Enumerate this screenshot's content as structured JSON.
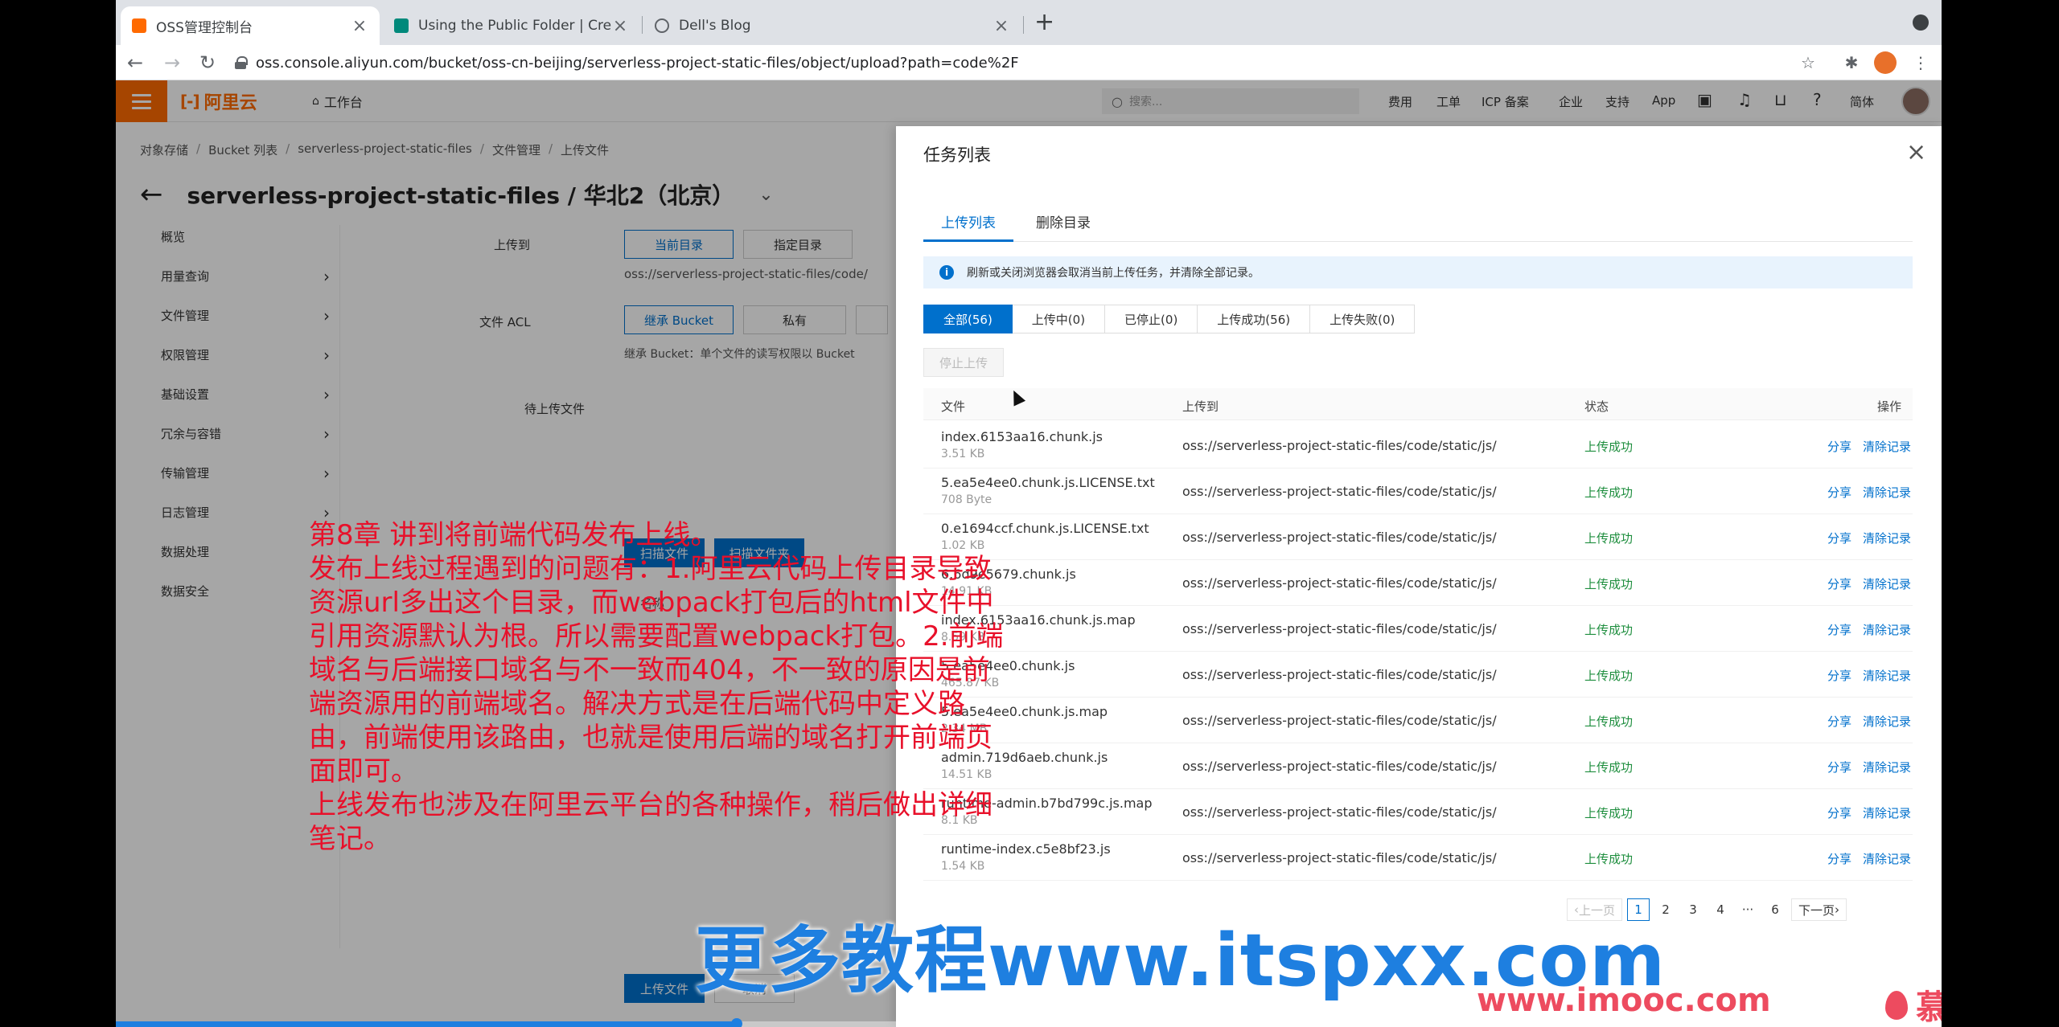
{
  "browser": {
    "tabs": [
      {
        "title": "OSS管理控制台",
        "color": "#ff6a00",
        "active": true
      },
      {
        "title": "Using the Public Folder | Creat",
        "color": "#00897b",
        "active": false
      },
      {
        "title": "Dell's Blog",
        "color": "#5f6368",
        "active": false
      }
    ],
    "new_tab": "+",
    "close": "×",
    "url": "oss.console.aliyun.com/bucket/oss-cn-beijing/serverless-project-static-files/object/upload?path=code%2F"
  },
  "console": {
    "brand": "阿里云",
    "brand_mark": "[-]",
    "workbench": "工作台",
    "search_placeholder": "搜索...",
    "top_links": [
      "费用",
      "工单",
      "ICP 备案",
      "企业",
      "支持",
      "App",
      "简体"
    ],
    "breadcrumb": [
      "对象存储",
      "Bucket 列表",
      "serverless-project-static-files",
      "文件管理",
      "上传文件"
    ],
    "bucket_title": "serverless-project-static-files / 华北2（北京）",
    "left_nav": [
      "概览",
      "用量查询",
      "文件管理",
      "权限管理",
      "基础设置",
      "冗余与容错",
      "传输管理",
      "日志管理",
      "数据处理",
      "数据安全"
    ],
    "form": {
      "upload_to_label": "上传到",
      "current_dir": "当前目录",
      "specify_dir": "指定目录",
      "path_preview": "oss://serverless-project-static-files/code/",
      "acl_label": "文件 ACL",
      "inherit_bucket": "继承 Bucket",
      "private": "私有",
      "acl_hint": "继承 Bucket：单个文件的读写权限以 Bucket",
      "pending_label": "待上传文件",
      "scan_file": "扫描文件",
      "scan_folder": "扫描文件夹",
      "name_col": "名称",
      "upload_btn": "上传文件",
      "cancel_btn": "取消"
    }
  },
  "panel": {
    "title": "任务列表",
    "tabs": [
      "上传列表",
      "删除目录"
    ],
    "notice": "刷新或关闭浏览器会取消当前上传任务，并清除全部记录。",
    "filters": [
      "全部(56)",
      "上传中(0)",
      "已停止(0)",
      "上传成功(56)",
      "上传失败(0)"
    ],
    "stop_btn": "停止上传",
    "columns": {
      "file": "文件",
      "dest": "上传到",
      "status": "状态",
      "ops": "操作"
    },
    "rows": [
      {
        "name": "index.6153aa16.chunk.js",
        "size": "3.51 KB",
        "dest": "oss://serverless-project-static-files/code/static/js/",
        "status": "上传成功",
        "share": "分享",
        "clear": "清除记录"
      },
      {
        "name": "5.ea5e4ee0.chunk.js.LICENSE.txt",
        "size": "708 Byte",
        "dest": "oss://serverless-project-static-files/code/static/js/",
        "status": "上传成功",
        "share": "分享",
        "clear": "清除记录"
      },
      {
        "name": "0.e1694ccf.chunk.js.LICENSE.txt",
        "size": "1.02 KB",
        "dest": "oss://serverless-project-static-files/code/static/js/",
        "status": "上传成功",
        "share": "分享",
        "clear": "清除记录"
      },
      {
        "name": "6.6d9e5679.chunk.js",
        "size": "14.91 KB",
        "dest": "oss://serverless-project-static-files/code/static/js/",
        "status": "上传成功",
        "share": "分享",
        "clear": "清除记录"
      },
      {
        "name": "index.6153aa16.chunk.js.map",
        "size": "8.59 KB",
        "dest": "oss://serverless-project-static-files/code/static/js/",
        "status": "上传成功",
        "share": "分享",
        "clear": "清除记录"
      },
      {
        "name": "5.ea5e4ee0.chunk.js",
        "size": "465.87 KB",
        "dest": "oss://serverless-project-static-files/code/static/js/",
        "status": "上传成功",
        "share": "分享",
        "clear": "清除记录"
      },
      {
        "name": "5.ea5e4ee0.chunk.js.map",
        "size": "2.34 MB",
        "dest": "oss://serverless-project-static-files/code/static/js/",
        "status": "上传成功",
        "share": "分享",
        "clear": "清除记录"
      },
      {
        "name": "admin.719d6aeb.chunk.js",
        "size": "14.51 KB",
        "dest": "oss://serverless-project-static-files/code/static/js/",
        "status": "上传成功",
        "share": "分享",
        "clear": "清除记录"
      },
      {
        "name": "runtime-admin.b7bd799c.js.map",
        "size": "8.1 KB",
        "dest": "oss://serverless-project-static-files/code/static/js/",
        "status": "上传成功",
        "share": "分享",
        "clear": "清除记录"
      },
      {
        "name": "runtime-index.c5e8bf23.js",
        "size": "1.54 KB",
        "dest": "oss://serverless-project-static-files/code/static/js/",
        "status": "上传成功",
        "share": "分享",
        "clear": "清除记录"
      }
    ],
    "pager": {
      "prev": "上一页",
      "pages": [
        "1",
        "2",
        "3",
        "4"
      ],
      "ellipsis": "···",
      "last": "6",
      "next": "下一页",
      "current": "1"
    }
  },
  "overlay": {
    "note_lines": [
      "第8章 讲到将前端代码发布上线。",
      "发布上线过程遇到的问题有：1.阿里云代码上传目录导致资源url多出这个目录，而webpack打包后的html文件中引用资源默认为根。所以需要配置webpack打包。2.前端域名与后端接口域名与不一致而404，不一致的原因是前端资源用的前端域名。解决方式是在后端代码中定义路由，前端使用该路由，也就是使用后端的域名打开前端页面即可。",
      "上线发布也涉及在阿里云平台的各种操作，稍后做出详细笔记。"
    ],
    "watermark": "更多教程www.itspxx.com",
    "imooc_url": "www.imooc.com",
    "imooc_brand": "慕课网",
    "video_progress": 0.34
  },
  "colors": {
    "accent": "#0070cc",
    "aliyun_orange": "#ff6a00",
    "success": "#1e8e3e",
    "annotation_red": "#e8102a"
  }
}
